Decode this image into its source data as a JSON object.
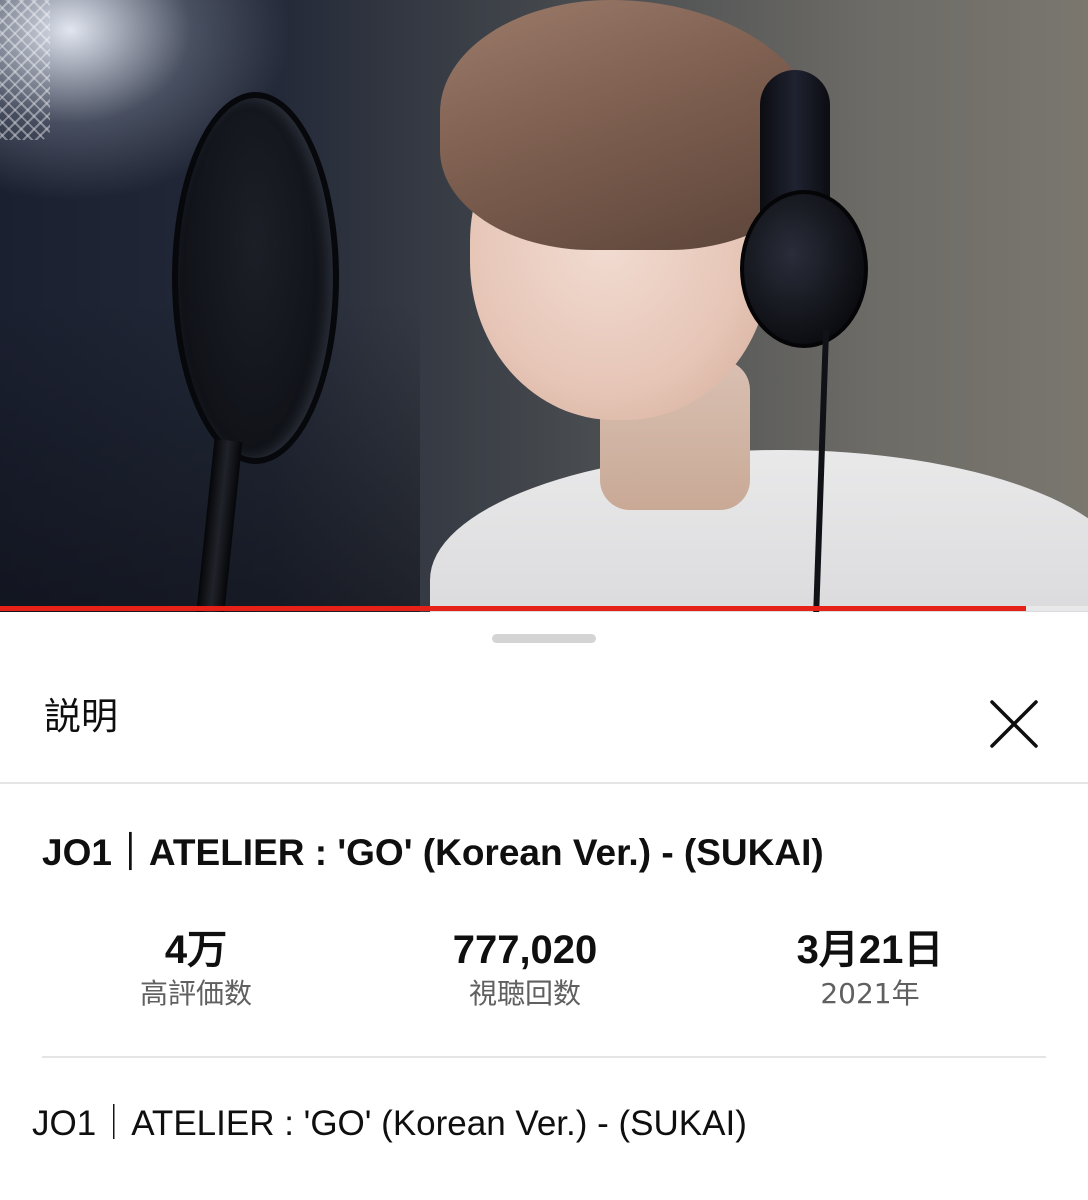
{
  "video": {
    "progress_fraction": 0.943,
    "progress_color": "#e62117"
  },
  "panel": {
    "title": "説明",
    "close_icon": "close-icon"
  },
  "video_title": "JO1｜ATELIER : 'GO' (Korean Ver.) -  (SUKAI)",
  "stats": {
    "likes": {
      "value": "4万",
      "label": "高評価数"
    },
    "views": {
      "value": "777,020",
      "label": "視聴回数"
    },
    "date": {
      "value": "3月21日",
      "label": "2021年"
    }
  },
  "description": "JO1｜ATELIER : 'GO' (Korean Ver.) -  (SUKAI)"
}
